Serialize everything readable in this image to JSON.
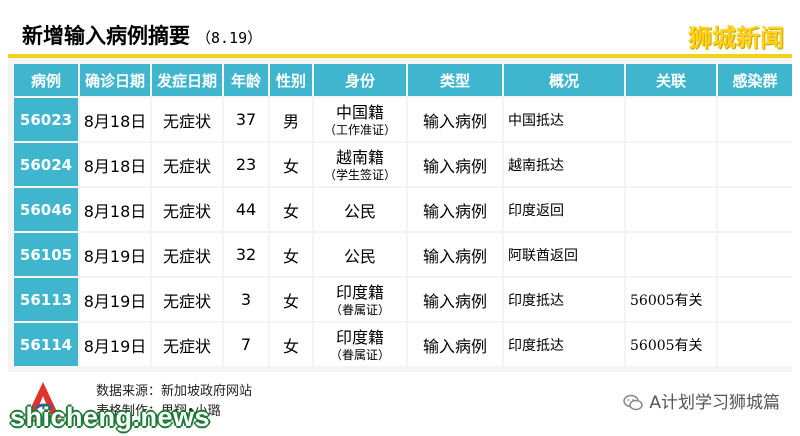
{
  "header": {
    "title": "新增输入病例摘要",
    "date": "（8.19）",
    "brand": "狮城新闻"
  },
  "table": {
    "headers": [
      "病例",
      "确诊日期",
      "发症日期",
      "年龄",
      "性别",
      "身份",
      "类型",
      "概况",
      "关联",
      "感染群"
    ],
    "rows": [
      {
        "id": "56023",
        "confirm": "8月18日",
        "onset": "无症状",
        "age": "37",
        "sex": "男",
        "identity": "中国籍",
        "identity_sub": "（工作准证）",
        "type": "输入病例",
        "overview": "中国抵达",
        "link": "",
        "cluster": ""
      },
      {
        "id": "56024",
        "confirm": "8月18日",
        "onset": "无症状",
        "age": "23",
        "sex": "女",
        "identity": "越南籍",
        "identity_sub": "（学生签证）",
        "type": "输入病例",
        "overview": "越南抵达",
        "link": "",
        "cluster": ""
      },
      {
        "id": "56046",
        "confirm": "8月18日",
        "onset": "无症状",
        "age": "44",
        "sex": "女",
        "identity": "公民",
        "identity_sub": "",
        "type": "输入病例",
        "overview": "印度返回",
        "link": "",
        "cluster": ""
      },
      {
        "id": "56105",
        "confirm": "8月19日",
        "onset": "无症状",
        "age": "32",
        "sex": "女",
        "identity": "公民",
        "identity_sub": "",
        "type": "输入病例",
        "overview": "阿联酋返回",
        "link": "",
        "cluster": ""
      },
      {
        "id": "56113",
        "confirm": "8月19日",
        "onset": "无症状",
        "age": "3",
        "sex": "女",
        "identity": "印度籍",
        "identity_sub": "（眷属证）",
        "type": "输入病例",
        "overview": "印度抵达",
        "link": "56005有关",
        "cluster": ""
      },
      {
        "id": "56114",
        "confirm": "8月19日",
        "onset": "无症状",
        "age": "7",
        "sex": "女",
        "identity": "印度籍",
        "identity_sub": "（眷属证）",
        "type": "输入病例",
        "overview": "印度抵达",
        "link": "56005有关",
        "cluster": ""
      }
    ]
  },
  "footer": {
    "source": "数据来源：新加坡政府网站",
    "credit": "表格制作：思翔•小璐",
    "wechat": "A计划学习狮城篇",
    "watermark": "shicheng.news"
  },
  "colors": {
    "accent": "#3fb6ce",
    "brand_yellow": "#ffd21f",
    "watermark_green": "#1c7a35"
  }
}
